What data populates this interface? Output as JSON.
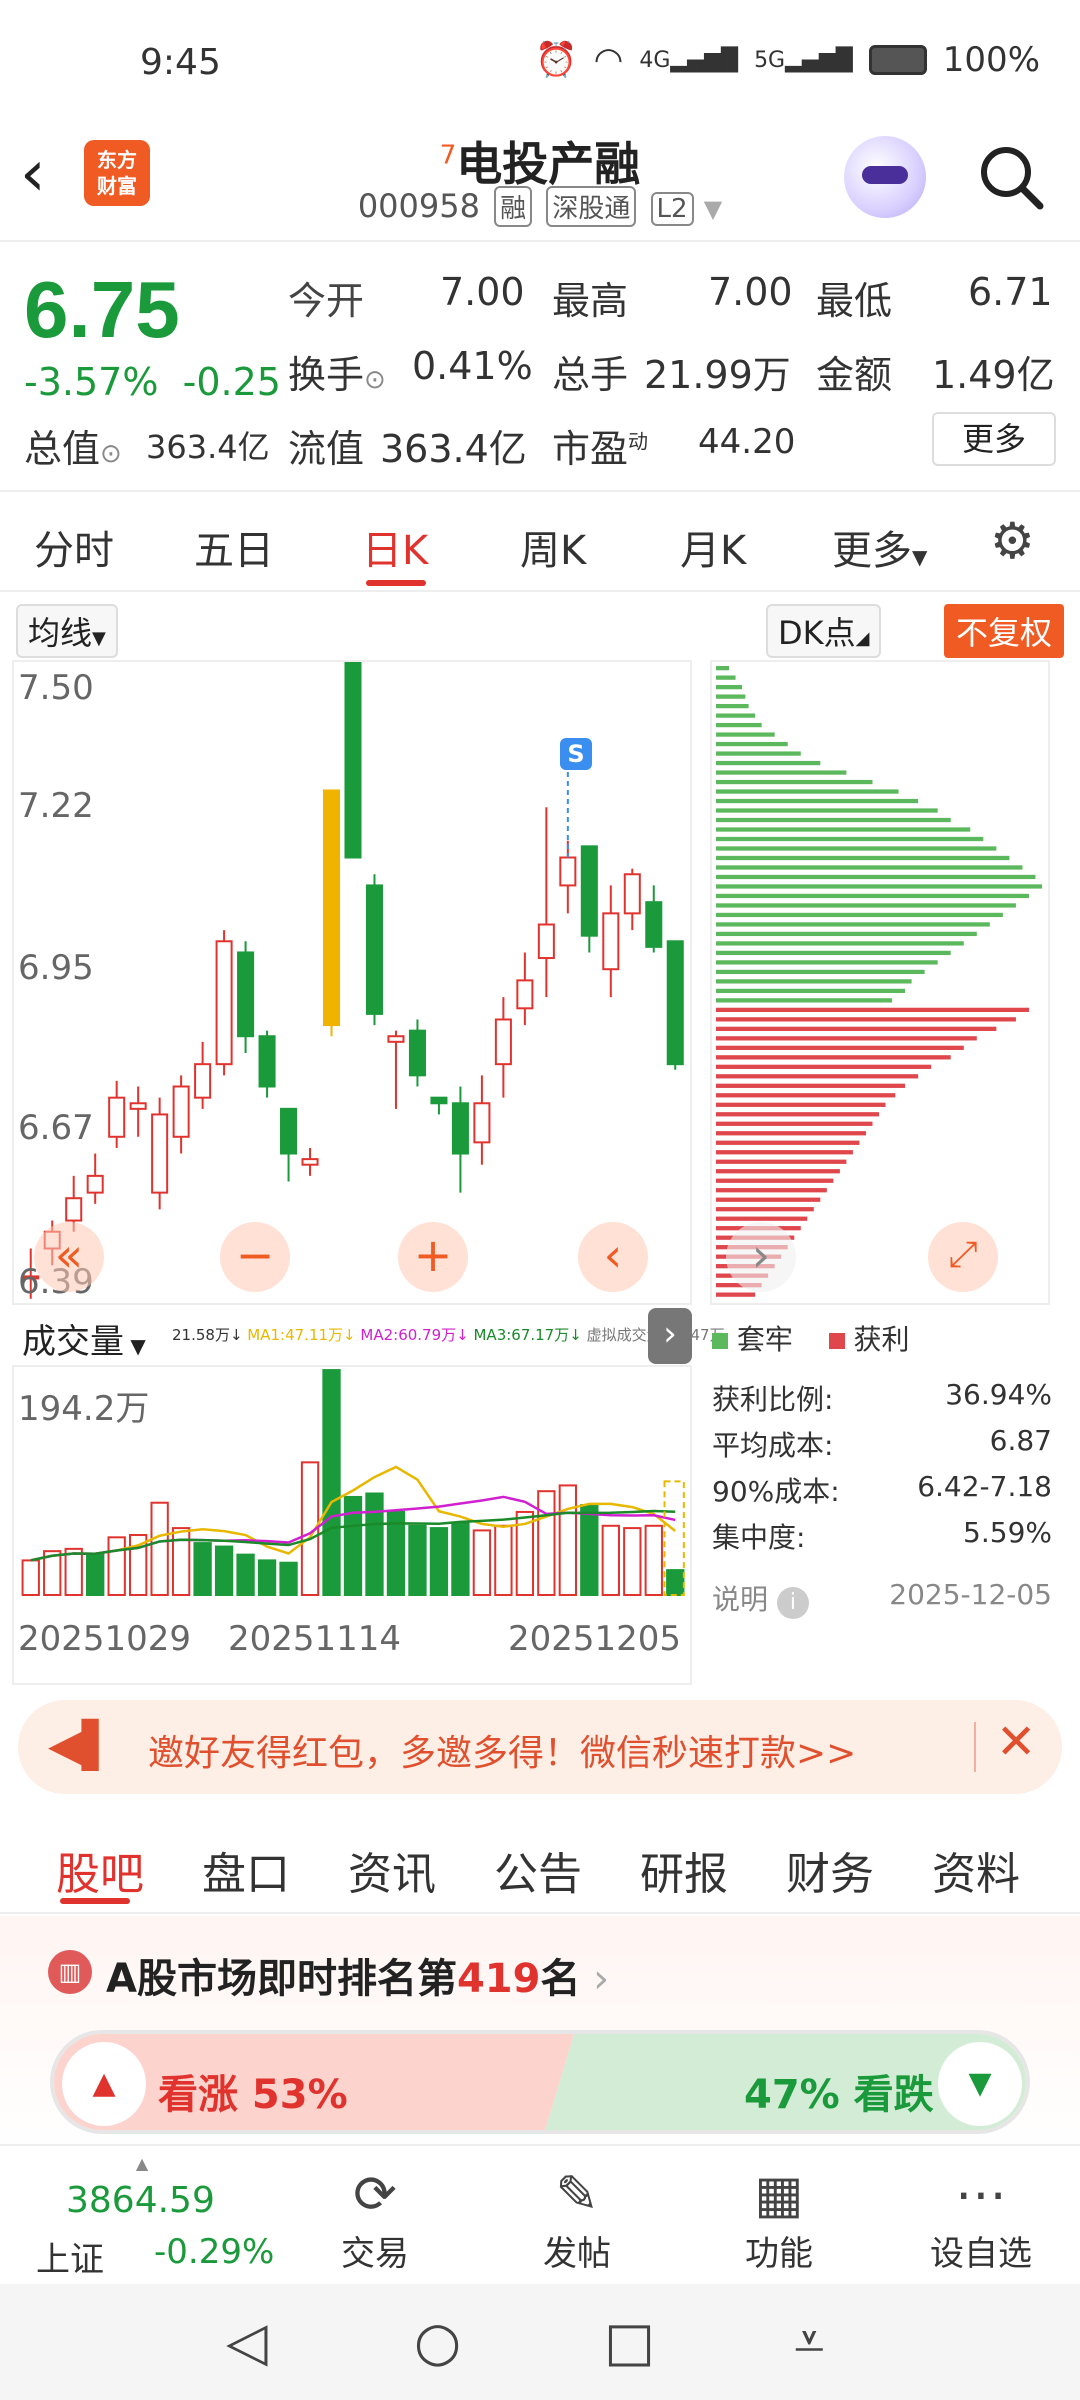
{
  "status": {
    "time": "9:45",
    "battery": "100%",
    "net1": "4G",
    "net2": "5G"
  },
  "header": {
    "logo_line1": "东方",
    "logo_line2": "财富",
    "badge": "7",
    "name": "电投产融",
    "code": "000958",
    "tags": [
      "融",
      "深股通",
      "L2"
    ]
  },
  "quote": {
    "price": "6.75",
    "change_pct": "-3.57%",
    "change": "-0.25",
    "open_label": "今开",
    "open": "7.00",
    "high_label": "最高",
    "high": "7.00",
    "low_label": "最低",
    "low": "6.71",
    "turnover_label": "换手",
    "turnover": "0.41%",
    "volume_label": "总手",
    "volume": "21.99万",
    "amount_label": "金额",
    "amount": "1.49亿",
    "mktcap_label": "总值",
    "mktcap": "363.4亿",
    "float_label": "流值",
    "float": "363.4亿",
    "pe_label": "市盈",
    "pe_sup": "动",
    "pe": "44.20",
    "more": "更多"
  },
  "tabs": [
    "分时",
    "五日",
    "日K",
    "周K",
    "月K",
    "更多"
  ],
  "chart_toolbar": {
    "ma": "均线",
    "dk": "DK点",
    "adjust": "不复权"
  },
  "chart_data": [
    {
      "type": "candlestick",
      "title": "日K",
      "ylim": [
        6.39,
        7.5
      ],
      "y_ticks": [
        "7.50",
        "7.22",
        "6.95",
        "6.67",
        "6.39"
      ],
      "marker": "S",
      "candles": [
        [
          6.4,
          6.45,
          6.36,
          6.4
        ],
        [
          6.45,
          6.5,
          6.42,
          6.48
        ],
        [
          6.5,
          6.58,
          6.48,
          6.54
        ],
        [
          6.55,
          6.62,
          6.53,
          6.58
        ],
        [
          6.65,
          6.75,
          6.63,
          6.72
        ],
        [
          6.7,
          6.74,
          6.65,
          6.71
        ],
        [
          6.55,
          6.72,
          6.52,
          6.69
        ],
        [
          6.65,
          6.76,
          6.62,
          6.74
        ],
        [
          6.72,
          6.82,
          6.7,
          6.78
        ],
        [
          6.78,
          7.02,
          6.76,
          7.0
        ],
        [
          6.98,
          7.0,
          6.8,
          6.83
        ],
        [
          6.83,
          6.84,
          6.72,
          6.74
        ],
        [
          6.7,
          6.7,
          6.57,
          6.62
        ],
        [
          6.6,
          6.63,
          6.58,
          6.61
        ],
        [
          6.85,
          7.27,
          6.83,
          7.27
        ],
        [
          7.51,
          7.51,
          7.15,
          7.15
        ],
        [
          7.1,
          7.12,
          6.85,
          6.87
        ],
        [
          6.82,
          6.84,
          6.7,
          6.83
        ],
        [
          6.84,
          6.86,
          6.74,
          6.76
        ],
        [
          6.72,
          6.72,
          6.69,
          6.71
        ],
        [
          6.71,
          6.74,
          6.55,
          6.62
        ],
        [
          6.64,
          6.76,
          6.6,
          6.71
        ],
        [
          6.78,
          6.9,
          6.72,
          6.86
        ],
        [
          6.88,
          6.98,
          6.85,
          6.93
        ],
        [
          6.97,
          7.24,
          6.9,
          7.03
        ],
        [
          7.1,
          7.18,
          7.05,
          7.15
        ],
        [
          7.17,
          7.17,
          6.98,
          7.01
        ],
        [
          6.95,
          7.1,
          6.9,
          7.05
        ],
        [
          7.05,
          7.13,
          7.02,
          7.12
        ],
        [
          7.07,
          7.1,
          6.98,
          6.99
        ],
        [
          7.0,
          7.0,
          6.77,
          6.78
        ]
      ]
    },
    {
      "type": "bar",
      "title": "成交量",
      "ylim": [
        0,
        194.2
      ],
      "y_ticks": [
        "194.2万"
      ],
      "x_ticks": [
        "20251029",
        "20251114",
        "20251205"
      ],
      "legend": "21.58万↓ MA1:47.11万↓ MA2:60.79万↓ MA3:67.17万↓ 虚拟成交量:98.47万",
      "values": [
        30,
        38,
        40,
        35,
        50,
        52,
        80,
        58,
        45,
        42,
        35,
        30,
        28,
        115,
        195,
        85,
        88,
        72,
        60,
        58,
        62,
        56,
        60,
        72,
        90,
        95,
        78,
        60,
        58,
        60,
        21.58
      ],
      "up": [
        1,
        1,
        1,
        0,
        1,
        1,
        1,
        1,
        0,
        0,
        0,
        0,
        0,
        1,
        0,
        0,
        0,
        0,
        0,
        0,
        0,
        1,
        1,
        1,
        1,
        1,
        0,
        1,
        1,
        1,
        0
      ]
    },
    {
      "type": "bar",
      "title": "筹码分布",
      "legend": [
        "套牢",
        "获利"
      ],
      "values_trapped": [
        4,
        6,
        8,
        9,
        10,
        12,
        14,
        18,
        22,
        26,
        32,
        40,
        48,
        56,
        62,
        68,
        72,
        78,
        82,
        86,
        90,
        94,
        98,
        100,
        96,
        92,
        88,
        84,
        80,
        76,
        72,
        68,
        64,
        60,
        58,
        54
      ],
      "values_profit": [
        96,
        92,
        86,
        80,
        76,
        72,
        66,
        62,
        58,
        55,
        52,
        50,
        48,
        46,
        44,
        42,
        40,
        38,
        36,
        34,
        32,
        30,
        28,
        26,
        24,
        22,
        20,
        18,
        16,
        14,
        12
      ]
    }
  ],
  "chip": {
    "legend_trapped": "套牢",
    "legend_profit": "获利",
    "profit_ratio_label": "获利比例:",
    "profit_ratio": "36.94%",
    "avg_cost_label": "平均成本:",
    "avg_cost": "6.87",
    "cost90_label": "90%成本:",
    "cost90": "6.42-7.18",
    "concentration_label": "集中度:",
    "concentration": "5.59%",
    "note": "说明",
    "date": "2025-12-05"
  },
  "volume": {
    "label": "成交量",
    "top": "194.2万",
    "legend_last": "21.58万↓",
    "legend_ma1": "MA1:47.11万↓",
    "legend_ma2": "MA2:60.79万↓",
    "legend_ma3": "MA3:67.17万↓",
    "legend_virtual": "虚拟成交量:98.47万",
    "dates": [
      "20251029",
      "20251114",
      "20251205"
    ]
  },
  "banner": {
    "text": "邀好友得红包，多邀多得！微信秒速打款>>"
  },
  "subtabs": [
    "股吧",
    "盘口",
    "资讯",
    "公告",
    "研报",
    "财务",
    "资料"
  ],
  "rank": {
    "prefix": "A股市场即时排名第",
    "num": "419",
    "suffix": "名"
  },
  "vote": {
    "up": "看涨 53%",
    "down": "47% 看跌"
  },
  "bottom": {
    "index_value": "3864.59",
    "index_name": "上证",
    "index_change": "-0.29%",
    "items": [
      "交易",
      "发帖",
      "功能",
      "设自选"
    ]
  },
  "colors": {
    "up": "#e0332e",
    "down": "#1a9a3a",
    "accent": "#f05a23",
    "ma1": "#e8b800",
    "ma2": "#d020d0",
    "ma3": "#1a8a2a"
  }
}
